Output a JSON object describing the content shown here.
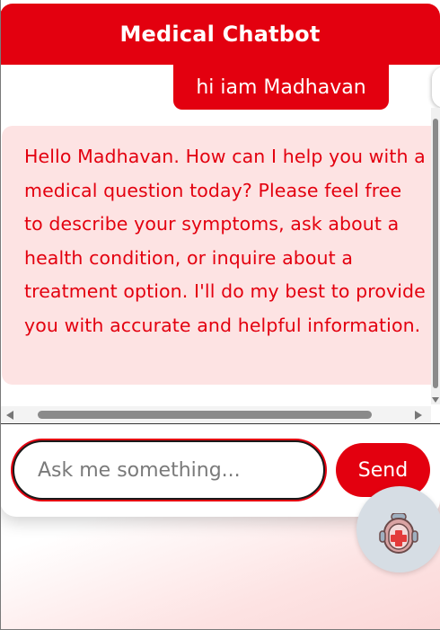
{
  "header": {
    "title": "Medical Chatbot"
  },
  "messages": [
    {
      "sender": "user",
      "text": "hi iam Madhavan"
    },
    {
      "sender": "bot",
      "text": "Hello Madhavan. How can I help you with a medical question today? Please feel free to describe your symptoms, ask about a health condition, or inquire about a treatment option. I'll do my best to provide you with accurate and helpful information."
    }
  ],
  "composer": {
    "placeholder": "Ask me something...",
    "value": "",
    "send_label": "Send"
  },
  "launcher": {
    "icon": "robot-doctor-icon"
  },
  "colors": {
    "accent": "#e3000f",
    "bot_bubble_bg": "#fde3e3",
    "launcher_bg": "#d6dde4"
  }
}
